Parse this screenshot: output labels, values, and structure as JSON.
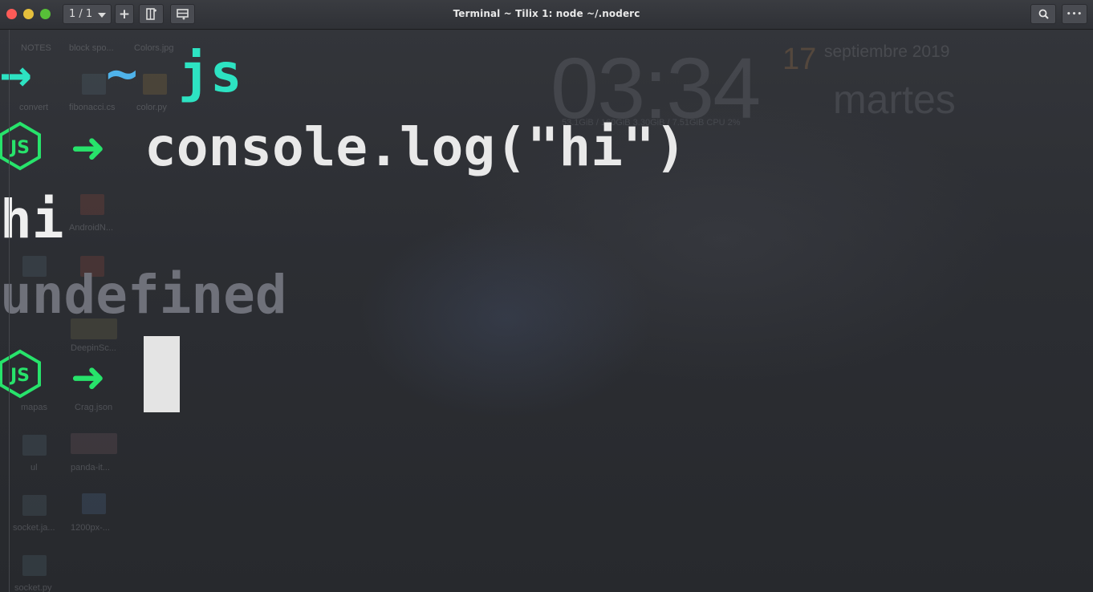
{
  "window": {
    "title": "Terminal ~ Tilix  1: node ~/.noderc",
    "session_label": "1 / 1",
    "add_label": "+",
    "more_label": "•••"
  },
  "desktop": {
    "clock": "03:34",
    "day": "17",
    "month_year": "septiembre 2019",
    "weekday": "martes",
    "stats": "53.1GiB / 160GiB     3.30GiB / 7.51GiB     CPU   2%",
    "icons": [
      {
        "label": "NOTES"
      },
      {
        "label": "block spo..."
      },
      {
        "label": "Colors.jpg"
      },
      {
        "label": "convert"
      },
      {
        "label": "fibonacci.cs"
      },
      {
        "label": "color.py"
      },
      {
        "label": "AndroidN..."
      },
      {
        "label": "DeepinSc..."
      },
      {
        "label": "mapas"
      },
      {
        "label": "Crag.json"
      },
      {
        "label": "ul"
      },
      {
        "label": "panda-it..."
      },
      {
        "label": "socket.ja..."
      },
      {
        "label": "1200px-..."
      },
      {
        "label": "socket.py"
      }
    ]
  },
  "terminal": {
    "prompt_arrow": "→",
    "prompt_tilde": "~",
    "prompt_dir": "js",
    "node_logo_text": "JS",
    "node_arrow": "➜",
    "command": "console.log(\"hi\")",
    "output": "hi",
    "return_value": "undefined"
  },
  "colors": {
    "prompt_teal": "#2de3c2",
    "tilde_blue": "#4fb3ea",
    "node_green": "#27e36b",
    "text_white": "#e9e9e9",
    "undefined_gray": "#6f717a"
  }
}
